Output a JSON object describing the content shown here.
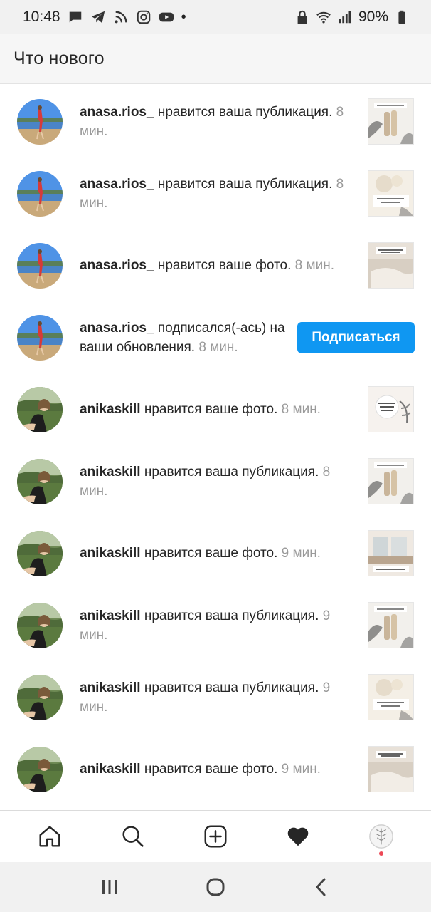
{
  "status_bar": {
    "time": "10:48",
    "battery": "90%",
    "left_icons": [
      "message-icon",
      "telegram-icon",
      "rss-icon",
      "instagram-icon",
      "youtube-icon"
    ],
    "right_icons": [
      "lock-icon",
      "wifi-icon",
      "signal-icon",
      "battery-icon"
    ]
  },
  "header": {
    "title": "Что нового"
  },
  "colors": {
    "follow_button": "#0f97f2",
    "username": "#262626",
    "time": "#9a9a9a",
    "notification_dot": "#ed4956"
  },
  "notifications": [
    {
      "user": "anasa.rios_",
      "action": " нравится ваша публикация.",
      "time": " 8 мин.",
      "thumb": "thumb-shoes"
    },
    {
      "user": "anasa.rios_",
      "action": " нравится ваша публикация.",
      "time": " 8 мин.",
      "thumb": "thumb-cream"
    },
    {
      "user": "anasa.rios_",
      "action": " нравится ваше фото.",
      "time": " 8 мин.",
      "thumb": "thumb-bed"
    },
    {
      "user": "anasa.rios_",
      "action": " подписался(-ась) на ваши обновления.",
      "time": " 8 мин.",
      "button": "Подписаться"
    },
    {
      "user": "anikaskill",
      "action": " нравится ваше фото.",
      "time": " 8 мин.",
      "thumb": "thumb-leaf"
    },
    {
      "user": "anikaskill",
      "action": " нравится ваша публикация.",
      "time": " 8 мин.",
      "thumb": "thumb-shoes"
    },
    {
      "user": "anikaskill",
      "action": " нравится ваше фото.",
      "time": " 9 мин.",
      "thumb": "thumb-room"
    },
    {
      "user": "anikaskill",
      "action": " нравится ваша публикация.",
      "time": " 9 мин.",
      "thumb": "thumb-shoes"
    },
    {
      "user": "anikaskill",
      "action": " нравится ваша публикация.",
      "time": " 9 мин.",
      "thumb": "thumb-cream"
    },
    {
      "user": "anikaskill",
      "action": " нравится ваше фото.",
      "time": " 9 мин.",
      "thumb": "thumb-bed"
    }
  ],
  "tab_bar": {
    "tabs": [
      "home-icon",
      "search-icon",
      "new-post-icon",
      "activity-heart-icon",
      "profile-avatar"
    ],
    "active": "activity-heart-icon"
  },
  "nav_bar": {
    "buttons": [
      "recent-apps-icon",
      "home-circle-icon",
      "back-chevron-icon"
    ]
  }
}
